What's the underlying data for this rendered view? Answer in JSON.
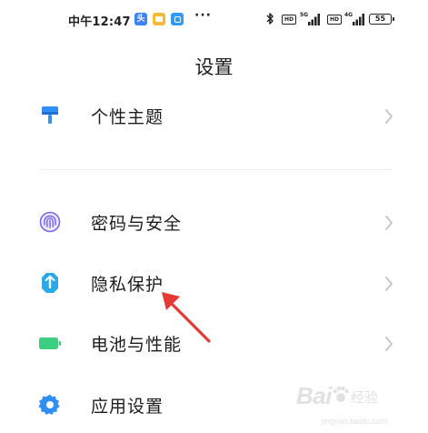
{
  "status_bar": {
    "time": "中午12:47",
    "notifications": [
      "头条",
      "文件",
      "便签"
    ],
    "more": "···",
    "network_1": "5G",
    "network_2": "4G",
    "hd_1": "HD",
    "hd_2": "HD",
    "battery": "55"
  },
  "header": {
    "title": "设置"
  },
  "settings": {
    "items": [
      {
        "label": "个性主题",
        "icon": "paint-brush-icon",
        "icon_color": "#2f8ff7"
      },
      {
        "label": "密码与安全",
        "icon": "fingerprint-icon",
        "icon_color": "#7b67e8"
      },
      {
        "label": "隐私保护",
        "icon": "privacy-shield-icon",
        "icon_color": "#2aa9e6"
      },
      {
        "label": "电池与性能",
        "icon": "battery-icon",
        "icon_color": "#3ccf82"
      },
      {
        "label": "应用设置",
        "icon": "gear-icon",
        "icon_color": "#2f8ff7"
      }
    ]
  },
  "watermark": {
    "brand": "Bai",
    "brand_sub": "经验",
    "url": "jingyan.baidu.com"
  },
  "colors": {
    "accent_blue": "#2f8ff7",
    "annotation_red": "#e53935",
    "chevron": "#c4c4c4"
  }
}
